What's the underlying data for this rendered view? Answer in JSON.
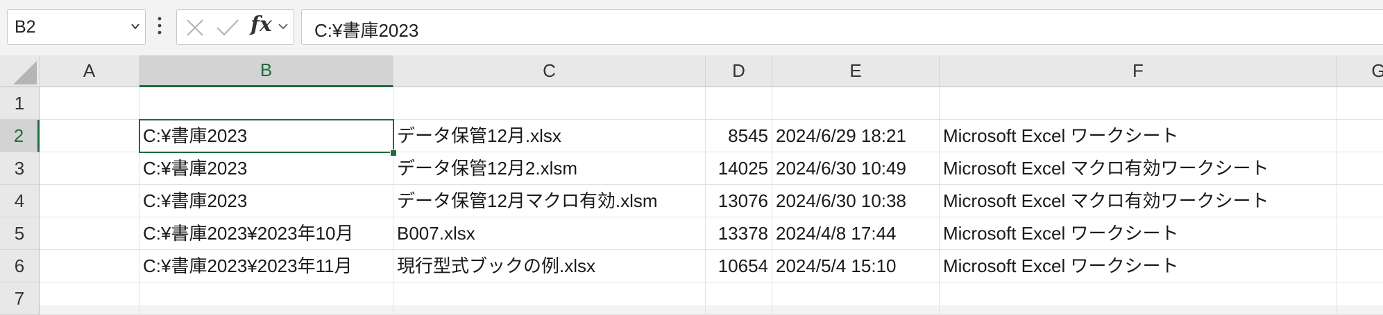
{
  "name_box": {
    "value": "B2"
  },
  "formula_bar": {
    "fx_label": "fx",
    "value": "C:¥書庫2023"
  },
  "columns": [
    "A",
    "B",
    "C",
    "D",
    "E",
    "F",
    "G"
  ],
  "rows": [
    {
      "num": "1",
      "cells": [
        "",
        "",
        "",
        "",
        "",
        "",
        ""
      ]
    },
    {
      "num": "2",
      "cells": [
        "",
        "C:¥書庫2023",
        "データ保管12月.xlsx",
        "8545",
        "2024/6/29 18:21",
        "Microsoft Excel ワークシート",
        ""
      ]
    },
    {
      "num": "3",
      "cells": [
        "",
        "C:¥書庫2023",
        "データ保管12月2.xlsm",
        "14025",
        "2024/6/30 10:49",
        "Microsoft Excel マクロ有効ワークシート",
        ""
      ]
    },
    {
      "num": "4",
      "cells": [
        "",
        "C:¥書庫2023",
        "データ保管12月マクロ有効.xlsm",
        "13076",
        "2024/6/30 10:38",
        "Microsoft Excel マクロ有効ワークシート",
        ""
      ]
    },
    {
      "num": "5",
      "cells": [
        "",
        "C:¥書庫2023¥2023年10月",
        "B007.xlsx",
        "13378",
        "2024/4/8 17:44",
        "Microsoft Excel ワークシート",
        ""
      ]
    },
    {
      "num": "6",
      "cells": [
        "",
        "C:¥書庫2023¥2023年11月",
        "現行型式ブックの例.xlsx",
        "10654",
        "2024/5/4 15:10",
        "Microsoft Excel ワークシート",
        ""
      ]
    },
    {
      "num": "7",
      "cells": [
        "",
        "",
        "",
        "",
        "",
        "",
        ""
      ]
    }
  ],
  "selected_cell": "B2",
  "colors": {
    "selection": "#1e6b3c",
    "header_bg": "#e8e8e8",
    "selected_header_bg": "#d3d3d3"
  }
}
